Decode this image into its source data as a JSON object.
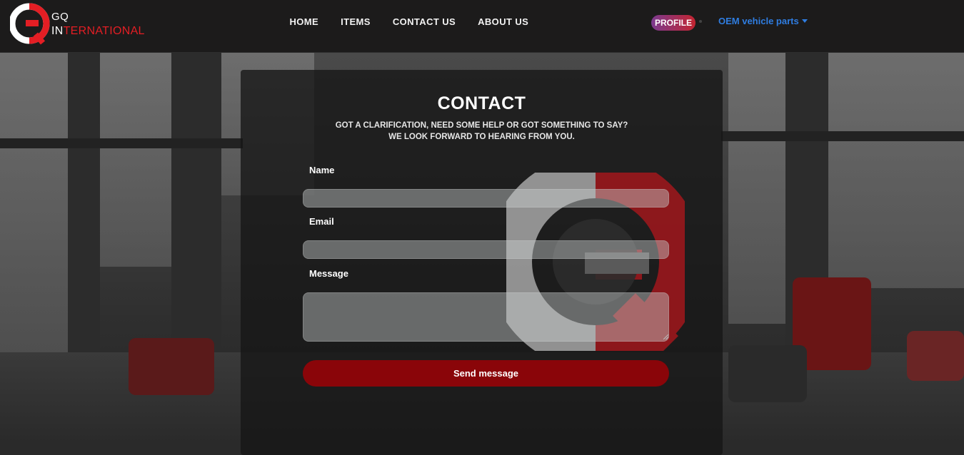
{
  "brand": {
    "line1": "GQ",
    "line2_white": "IN",
    "line2_red": "TERNATIONAL",
    "logo_icon": "gq-logo-icon",
    "colors": {
      "red": "#e31e24",
      "white": "#ffffff"
    }
  },
  "nav": {
    "links": [
      "HOME",
      "ITEMS",
      "CONTACT US",
      "ABOUT US"
    ],
    "profile_label": "PROFILE",
    "dropdown_label": "OEM vehicle parts"
  },
  "contact": {
    "title": "CONTACT",
    "subtitle_line1": "GOT A CLARIFICATION, NEED SOME HELP OR GOT SOMETHING TO SAY?",
    "subtitle_line2": "WE LOOK FORWARD TO HEARING FROM YOU.",
    "fields": {
      "name": {
        "label": "Name",
        "value": ""
      },
      "email": {
        "label": "Email",
        "value": ""
      },
      "message": {
        "label": "Message",
        "value": ""
      }
    },
    "submit_label": "Send message",
    "watermark_icon": "gq-watermark-logo"
  },
  "colors": {
    "navbar_bg": "#1c1b1b",
    "accent_red": "#8a0509",
    "link_blue": "#2f7de1"
  }
}
